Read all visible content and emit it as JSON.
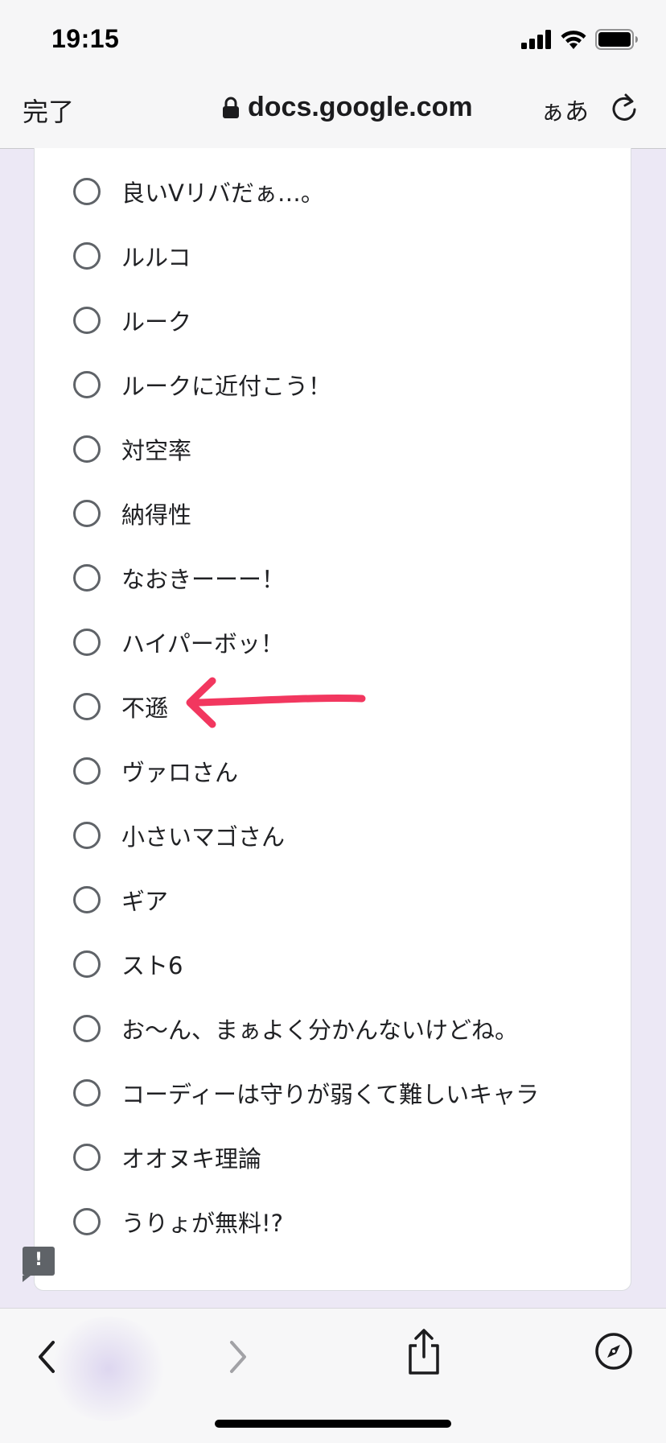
{
  "status_bar": {
    "time": "19:15",
    "icons": [
      "cellular-signal-icon",
      "wifi-icon",
      "battery-icon"
    ]
  },
  "browser": {
    "done_label": "完了",
    "url": "docs.google.com",
    "reader_label": "ぁあ",
    "icons": [
      "lock-icon",
      "reload-icon"
    ]
  },
  "form": {
    "options": [
      {
        "label": "良いVリバだぁ…。"
      },
      {
        "label": "ルルコ"
      },
      {
        "label": "ルーク"
      },
      {
        "label": "ルークに近付こう！"
      },
      {
        "label": "対空率"
      },
      {
        "label": "納得性"
      },
      {
        "label": "なおきーーー！"
      },
      {
        "label": "ハイパーボッ！"
      },
      {
        "label": "不遜"
      },
      {
        "label": "ヴァロさん"
      },
      {
        "label": "小さいマゴさん"
      },
      {
        "label": "ギア"
      },
      {
        "label": "スト6"
      },
      {
        "label": "お〜ん、まぁよく分かんないけどね。"
      },
      {
        "label": "コーディーは守りが弱くて難しいキャラ"
      },
      {
        "label": "オオヌキ理論"
      },
      {
        "label": "うりょが無料!?"
      }
    ],
    "annotation": {
      "type": "arrow",
      "color": "#f2375f",
      "points_to": "不遜"
    },
    "feedback_button": {
      "label": "!"
    }
  },
  "toolbar": {
    "buttons": [
      "back-icon",
      "forward-icon",
      "share-icon",
      "compass-icon"
    ]
  },
  "colors": {
    "page_background": "#ece8f5",
    "card_background": "#ffffff",
    "radio_border": "#5f6368",
    "annotation_arrow": "#f2375f"
  }
}
